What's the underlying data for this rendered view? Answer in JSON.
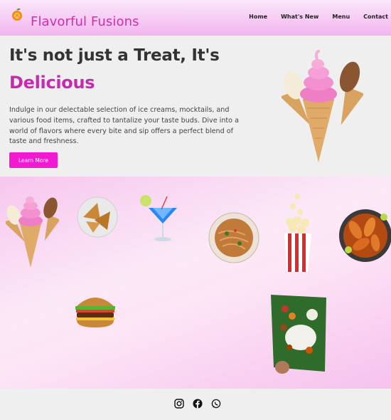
{
  "header": {
    "brand": "Flavorful Fusions",
    "logo_icon": "orange-fruit-icon",
    "nav": [
      "Home",
      "What's New",
      "Menu",
      "Contact"
    ]
  },
  "hero": {
    "title_line1": "It's not just a Treat, It's",
    "title_line2": "Delicious",
    "description": "Indulge in our delectable selection of ice creams, mocktails, and various food items, crafted to tantalize your taste buds. Dive into a world of flavors where every bite and sip offers a perfect blend of taste and freshness.",
    "button_label": "Learn More",
    "image": "ice-cream-cones-image"
  },
  "gallery": {
    "items": [
      "ice-cream-cones",
      "samosa-plate",
      "blue-mocktail",
      "noodles-plate",
      "popcorn-bucket",
      "chicken-dish",
      "burger",
      "banana-leaf-meal"
    ]
  },
  "footer": {
    "icons": [
      "instagram-icon",
      "facebook-icon",
      "whatsapp-icon"
    ]
  },
  "colors": {
    "brand": "#d12ea8",
    "accent": "#f01ad0",
    "header_gradient_top": "#fbe7fb",
    "header_gradient_bottom": "#f2b4ee"
  }
}
